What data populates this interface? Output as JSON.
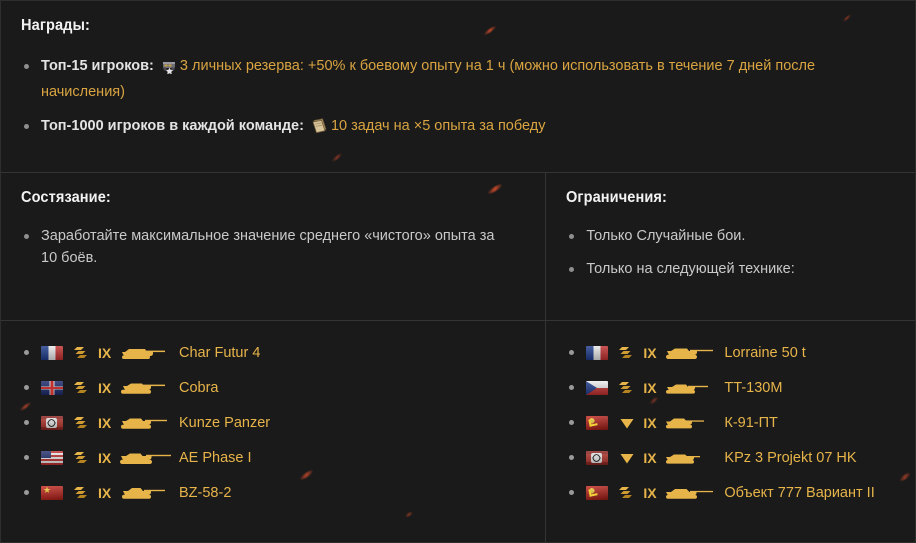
{
  "colors": {
    "background": "#1a1a1a",
    "divider": "#343434",
    "gold": "#d9a441",
    "tank_gold": "#e7b44a",
    "body_text": "#c9c9c9",
    "heading_text": "#f2f2f2",
    "bullet": "#8e8e8e"
  },
  "rewards": {
    "heading": "Награды:",
    "items": [
      {
        "label": "Топ-15 игроков:",
        "icon": "personal-reserve-icon",
        "gold_text": "3 личных резерва: +50% к боевому опыту на 1 ч",
        "tail_text": " (можно использовать в течение 7 дней после начисления)"
      },
      {
        "label": "Топ-1000 игроков в каждой команде:",
        "icon": "booklet-icon",
        "gold_text": "10 задач на ×5 опыта за победу",
        "tail_text": ""
      }
    ]
  },
  "competition": {
    "heading": "Состязание:",
    "items": [
      "Заработайте максимальное значение среднего «чистого» опыта за 10 боёв."
    ]
  },
  "restrictions": {
    "heading": "Ограничения:",
    "items": [
      "Только Случайные бои.",
      "Только на следующей технике:"
    ]
  },
  "tanks_left": [
    {
      "nation": "france",
      "flag_icon": "flag-france-icon",
      "class": "medium",
      "class_icon": "medium-tank-class-icon",
      "tier": "IX",
      "name": "Char Futur 4"
    },
    {
      "nation": "uk",
      "flag_icon": "flag-uk-icon",
      "class": "medium",
      "class_icon": "medium-tank-class-icon",
      "tier": "IX",
      "name": "Cobra"
    },
    {
      "nation": "germany",
      "flag_icon": "flag-germany-icon",
      "class": "medium",
      "class_icon": "medium-tank-class-icon",
      "tier": "IX",
      "name": "Kunze Panzer"
    },
    {
      "nation": "usa",
      "flag_icon": "flag-usa-icon",
      "class": "medium",
      "class_icon": "medium-tank-class-icon",
      "tier": "IX",
      "name": "AE Phase I"
    },
    {
      "nation": "china",
      "flag_icon": "flag-china-icon",
      "class": "medium",
      "class_icon": "medium-tank-class-icon",
      "tier": "IX",
      "name": "BZ-58-2"
    }
  ],
  "tanks_right": [
    {
      "nation": "france",
      "flag_icon": "flag-france-icon",
      "class": "medium",
      "class_icon": "medium-tank-class-icon",
      "tier": "IX",
      "name": "Lorraine 50 t"
    },
    {
      "nation": "czech",
      "flag_icon": "flag-czechoslovakia-icon",
      "class": "medium",
      "class_icon": "medium-tank-class-icon",
      "tier": "IX",
      "name": "TT-130M"
    },
    {
      "nation": "ussr",
      "flag_icon": "flag-ussr-icon",
      "class": "tank-destroyer",
      "class_icon": "tank-destroyer-class-icon",
      "tier": "IX",
      "name": "К-91-ПТ"
    },
    {
      "nation": "germany",
      "flag_icon": "flag-germany-icon",
      "class": "tank-destroyer",
      "class_icon": "tank-destroyer-class-icon",
      "tier": "IX",
      "name": "KPz 3 Projekt 07 HK"
    },
    {
      "nation": "ussr",
      "flag_icon": "flag-ussr-icon",
      "class": "medium",
      "class_icon": "medium-tank-class-icon",
      "tier": "IX",
      "name": "Объект 777 Вариант II"
    }
  ]
}
